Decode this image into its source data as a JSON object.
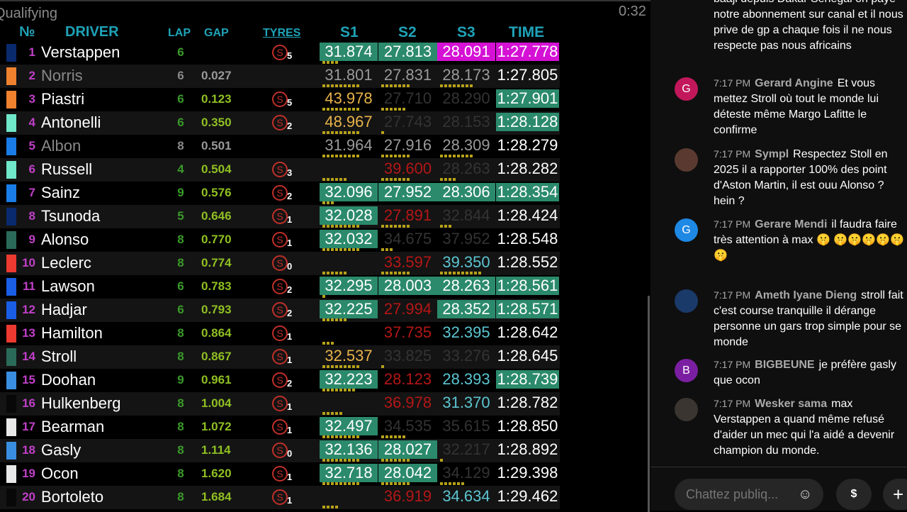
{
  "session": "Qualifying",
  "clock": "0:32",
  "headers": {
    "no": "№",
    "driver": "DRIVER",
    "lap": "LAP",
    "gap": "GAP",
    "tyres": "TYRES",
    "s1": "S1",
    "s2": "S2",
    "s3": "S3",
    "time": "TIME"
  },
  "tyre_letter": "S",
  "colors": {
    "pb": "#2b8a6b",
    "overall_best": "#d411d4",
    "header": "#1fa3b8"
  },
  "rows": [
    {
      "pos": "1",
      "name": "Verstappen",
      "team": "#0a2a6e",
      "lap": "6",
      "gap": "",
      "tyre": "5",
      "s": [
        [
          "31.874",
          "pb"
        ],
        [
          "27.813",
          "pb"
        ],
        [
          "28.091",
          "ob"
        ]
      ],
      "time": [
        "1:27.778",
        "ob"
      ],
      "dots": [
        4,
        0,
        0
      ]
    },
    {
      "pos": "2",
      "name": "Norris",
      "team": "#f0812e",
      "lap": "6",
      "gap": "0.027",
      "tyre": "",
      "grey": true,
      "s": [
        [
          "31.801",
          "grey"
        ],
        [
          "27.831",
          "grey"
        ],
        [
          "28.173",
          "grey"
        ]
      ],
      "time": [
        "1:27.805",
        "white"
      ],
      "dots": [
        9,
        7,
        8
      ]
    },
    {
      "pos": "3",
      "name": "Piastri",
      "team": "#f0812e",
      "lap": "6",
      "gap": "0.123",
      "tyre": "5",
      "s": [
        [
          "43.978",
          "yel"
        ],
        [
          "27.710",
          "dim"
        ],
        [
          "28.290",
          "dim"
        ]
      ],
      "time": [
        "1:27.901",
        "pb"
      ],
      "dots": [
        9,
        6,
        0
      ]
    },
    {
      "pos": "4",
      "name": "Antonelli",
      "team": "#6fe7c8",
      "lap": "6",
      "gap": "0.350",
      "tyre": "2",
      "s": [
        [
          "48.967",
          "yel"
        ],
        [
          "27.743",
          "dim"
        ],
        [
          "28.153",
          "dim"
        ]
      ],
      "time": [
        "1:28.128",
        "pb"
      ],
      "dots": [
        9,
        1,
        0
      ]
    },
    {
      "pos": "5",
      "name": "Albon",
      "team": "#1a7ce6",
      "lap": "8",
      "gap": "0.501",
      "tyre": "",
      "grey": true,
      "s": [
        [
          "31.964",
          "grey"
        ],
        [
          "27.916",
          "grey"
        ],
        [
          "28.309",
          "grey"
        ]
      ],
      "time": [
        "1:28.279",
        "white"
      ],
      "dots": [
        9,
        7,
        8
      ]
    },
    {
      "pos": "6",
      "name": "Russell",
      "team": "#6fe7c8",
      "lap": "4",
      "gap": "0.504",
      "tyre": "3",
      "s": [
        [
          "",
          "grey"
        ],
        [
          "39.600",
          "red"
        ],
        [
          "28.263",
          "dim"
        ]
      ],
      "time": [
        "1:28.282",
        "white"
      ],
      "dots": [
        6,
        7,
        4
      ]
    },
    {
      "pos": "7",
      "name": "Sainz",
      "team": "#1a7ce6",
      "lap": "9",
      "gap": "0.576",
      "tyre": "2",
      "s": [
        [
          "32.096",
          "pb"
        ],
        [
          "27.952",
          "pb"
        ],
        [
          "28.306",
          "pb"
        ]
      ],
      "time": [
        "1:28.354",
        "pb"
      ],
      "dots": [
        3,
        0,
        0
      ]
    },
    {
      "pos": "8",
      "name": "Tsunoda",
      "team": "#0a2a6e",
      "lap": "5",
      "gap": "0.646",
      "tyre": "1",
      "s": [
        [
          "32.028",
          "pb"
        ],
        [
          "27.891",
          "red"
        ],
        [
          "32.844",
          "dim"
        ]
      ],
      "time": [
        "1:28.424",
        "white"
      ],
      "dots": [
        9,
        7,
        3
      ]
    },
    {
      "pos": "9",
      "name": "Alonso",
      "team": "#2a6a58",
      "lap": "8",
      "gap": "0.770",
      "tyre": "1",
      "s": [
        [
          "32.032",
          "pb"
        ],
        [
          "34.675",
          "dim"
        ],
        [
          "37.952",
          "dim"
        ]
      ],
      "time": [
        "1:28.548",
        "white"
      ],
      "dots": [
        9,
        3,
        0
      ]
    },
    {
      "pos": "10",
      "name": "Leclerc",
      "team": "#ec3a30",
      "lap": "8",
      "gap": "0.774",
      "tyre": "0",
      "s": [
        [
          "",
          "grey"
        ],
        [
          "33.597",
          "red"
        ],
        [
          "39.350",
          "cyan"
        ]
      ],
      "time": [
        "1:28.552",
        "white"
      ],
      "dots": [
        6,
        7,
        10
      ]
    },
    {
      "pos": "11",
      "name": "Lawson",
      "team": "#1a5ee6",
      "lap": "6",
      "gap": "0.783",
      "tyre": "2",
      "s": [
        [
          "32.295",
          "pb"
        ],
        [
          "28.003",
          "pb"
        ],
        [
          "28.263",
          "pb"
        ]
      ],
      "time": [
        "1:28.561",
        "pb"
      ],
      "dots": [
        1,
        0,
        0
      ]
    },
    {
      "pos": "12",
      "name": "Hadjar",
      "team": "#1a5ee6",
      "lap": "6",
      "gap": "0.793",
      "tyre": "2",
      "s": [
        [
          "32.225",
          "pb"
        ],
        [
          "27.994",
          "red"
        ],
        [
          "28.352",
          "pb"
        ]
      ],
      "time": [
        "1:28.571",
        "pb"
      ],
      "dots": [
        6,
        0,
        0
      ]
    },
    {
      "pos": "13",
      "name": "Hamilton",
      "team": "#ec3a30",
      "lap": "8",
      "gap": "0.864",
      "tyre": "1",
      "s": [
        [
          "",
          "grey"
        ],
        [
          "37.735",
          "red"
        ],
        [
          "32.395",
          "cyan"
        ]
      ],
      "time": [
        "1:28.642",
        "white"
      ],
      "dots": [
        3,
        0,
        0
      ]
    },
    {
      "pos": "14",
      "name": "Stroll",
      "team": "#2a6a58",
      "lap": "8",
      "gap": "0.867",
      "tyre": "1",
      "s": [
        [
          "32.537",
          "yel"
        ],
        [
          "33.825",
          "dim"
        ],
        [
          "33.276",
          "dim"
        ]
      ],
      "time": [
        "1:28.645",
        "white"
      ],
      "dots": [
        9,
        1,
        0
      ]
    },
    {
      "pos": "15",
      "name": "Doohan",
      "team": "#3a8ee0",
      "lap": "9",
      "gap": "0.961",
      "tyre": "2",
      "s": [
        [
          "32.223",
          "pb"
        ],
        [
          "28.123",
          "red"
        ],
        [
          "28.393",
          "cyan"
        ]
      ],
      "time": [
        "1:28.739",
        "pb"
      ],
      "dots": [
        8,
        0,
        0
      ]
    },
    {
      "pos": "16",
      "name": "Hulkenberg",
      "team": "#080808",
      "lap": "8",
      "gap": "1.004",
      "tyre": "1",
      "s": [
        [
          "",
          "grey"
        ],
        [
          "36.978",
          "red"
        ],
        [
          "31.370",
          "cyan"
        ]
      ],
      "time": [
        "1:28.782",
        "white"
      ],
      "dots": [
        5,
        0,
        0
      ]
    },
    {
      "pos": "17",
      "name": "Bearman",
      "team": "#e8e8e8",
      "lap": "8",
      "gap": "1.072",
      "tyre": "1",
      "s": [
        [
          "32.497",
          "pb"
        ],
        [
          "34.535",
          "dim"
        ],
        [
          "35.615",
          "dim"
        ]
      ],
      "time": [
        "1:28.850",
        "white"
      ],
      "dots": [
        9,
        6,
        0
      ]
    },
    {
      "pos": "18",
      "name": "Gasly",
      "team": "#3a8ee0",
      "lap": "8",
      "gap": "1.114",
      "tyre": "0",
      "s": [
        [
          "32.136",
          "pb"
        ],
        [
          "28.027",
          "pb"
        ],
        [
          "32.217",
          "dim"
        ]
      ],
      "time": [
        "1:28.892",
        "white"
      ],
      "dots": [
        9,
        7,
        1
      ]
    },
    {
      "pos": "19",
      "name": "Ocon",
      "team": "#e8e8e8",
      "lap": "8",
      "gap": "1.620",
      "tyre": "1",
      "s": [
        [
          "32.718",
          "pb"
        ],
        [
          "28.042",
          "pb"
        ],
        [
          "34.129",
          "dim"
        ]
      ],
      "time": [
        "1:29.398",
        "white"
      ],
      "dots": [
        9,
        7,
        6
      ]
    },
    {
      "pos": "20",
      "name": "Bortoleto",
      "team": "#080808",
      "lap": "8",
      "gap": "1.684",
      "tyre": "1",
      "s": [
        [
          "",
          "grey"
        ],
        [
          "36.919",
          "red"
        ],
        [
          "34.634",
          "cyan"
        ]
      ],
      "time": [
        "1:29.462",
        "white"
      ],
      "dots": [
        4,
        0,
        0
      ]
    }
  ],
  "chat": {
    "messages": [
      {
        "time": "",
        "author": "",
        "text": "baaji depuis Dakar Senegal on paye notre abonnement sur canal et il nous prive de gp a chaque fois il ne nous respecte pas nous africains",
        "avatar": "",
        "avatar_color": ""
      },
      {
        "time": "7:17 PM",
        "author": "Gerard Angine",
        "text": "Et vous mettez Stroll où tout le monde lui déteste même Margo Lafitte le confirme",
        "avatar": "G",
        "avatar_color": "#c2185b"
      },
      {
        "time": "7:17 PM",
        "author": "Sympl",
        "text": "Respectez Stoll en 2025 il a rapporter 100% des point d'Aston Martin, il est ouu Alonso ? hein ?",
        "avatar": "",
        "avatar_color": "#5a3a30"
      },
      {
        "time": "7:17 PM",
        "author": "Gerare Mendi",
        "text": "il faudra faire très attention à max 🤫 🤫🤫🤫🤫🤫🤫",
        "avatar": "G",
        "avatar_color": "#1e88e5"
      },
      {
        "time": "7:17 PM",
        "author": "Ameth Iyane Dieng",
        "text": "stroll fait c'est course tranquille il dérange personne un gars trop simple pour se monde",
        "avatar": "",
        "avatar_color": "#1a3a6a"
      },
      {
        "time": "7:17 PM",
        "author": "BIGBEUNE",
        "text": "je préfère gasly que ocon",
        "avatar": "B",
        "avatar_color": "#7b1fa2"
      },
      {
        "time": "7:17 PM",
        "author": "Wesker sama",
        "text": "max Verstappen a quand même refusé d'aider un mec qui l'a aidé a devenir champion du monde.",
        "avatar": "",
        "avatar_color": "#3a3530"
      }
    ],
    "input_placeholder": "Chattez publiq...",
    "superchat_label": "$",
    "plus_label": "+",
    "emoji_label": "☺"
  }
}
